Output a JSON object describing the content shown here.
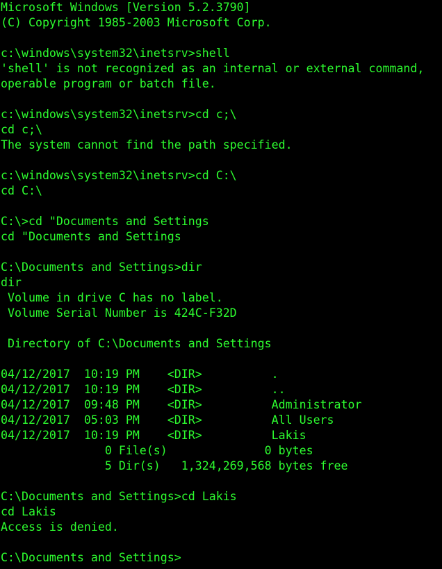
{
  "theme": {
    "background": "#000000",
    "foreground": "#2dfc2f"
  },
  "terminal": {
    "lines": [
      "Microsoft Windows [Version 5.2.3790]",
      "(C) Copyright 1985-2003 Microsoft Corp.",
      "",
      "c:\\windows\\system32\\inetsrv>shell",
      "'shell' is not recognized as an internal or external command,",
      "operable program or batch file.",
      "",
      "c:\\windows\\system32\\inetsrv>cd c;\\",
      "cd c;\\",
      "The system cannot find the path specified.",
      "",
      "c:\\windows\\system32\\inetsrv>cd C:\\",
      "cd C:\\",
      "",
      "C:\\>cd \"Documents and Settings",
      "cd \"Documents and Settings",
      "",
      "C:\\Documents and Settings>dir",
      "dir",
      " Volume in drive C has no label.",
      " Volume Serial Number is 424C-F32D",
      "",
      " Directory of C:\\Documents and Settings",
      "",
      "04/12/2017  10:19 PM    <DIR>          .",
      "04/12/2017  10:19 PM    <DIR>          ..",
      "04/12/2017  09:48 PM    <DIR>          Administrator",
      "04/12/2017  05:03 PM    <DIR>          All Users",
      "04/12/2017  10:19 PM    <DIR>          Lakis",
      "               0 File(s)              0 bytes",
      "               5 Dir(s)   1,324,269,568 bytes free",
      "",
      "C:\\Documents and Settings>cd Lakis",
      "cd Lakis",
      "Access is denied.",
      "",
      "C:\\Documents and Settings>"
    ]
  }
}
